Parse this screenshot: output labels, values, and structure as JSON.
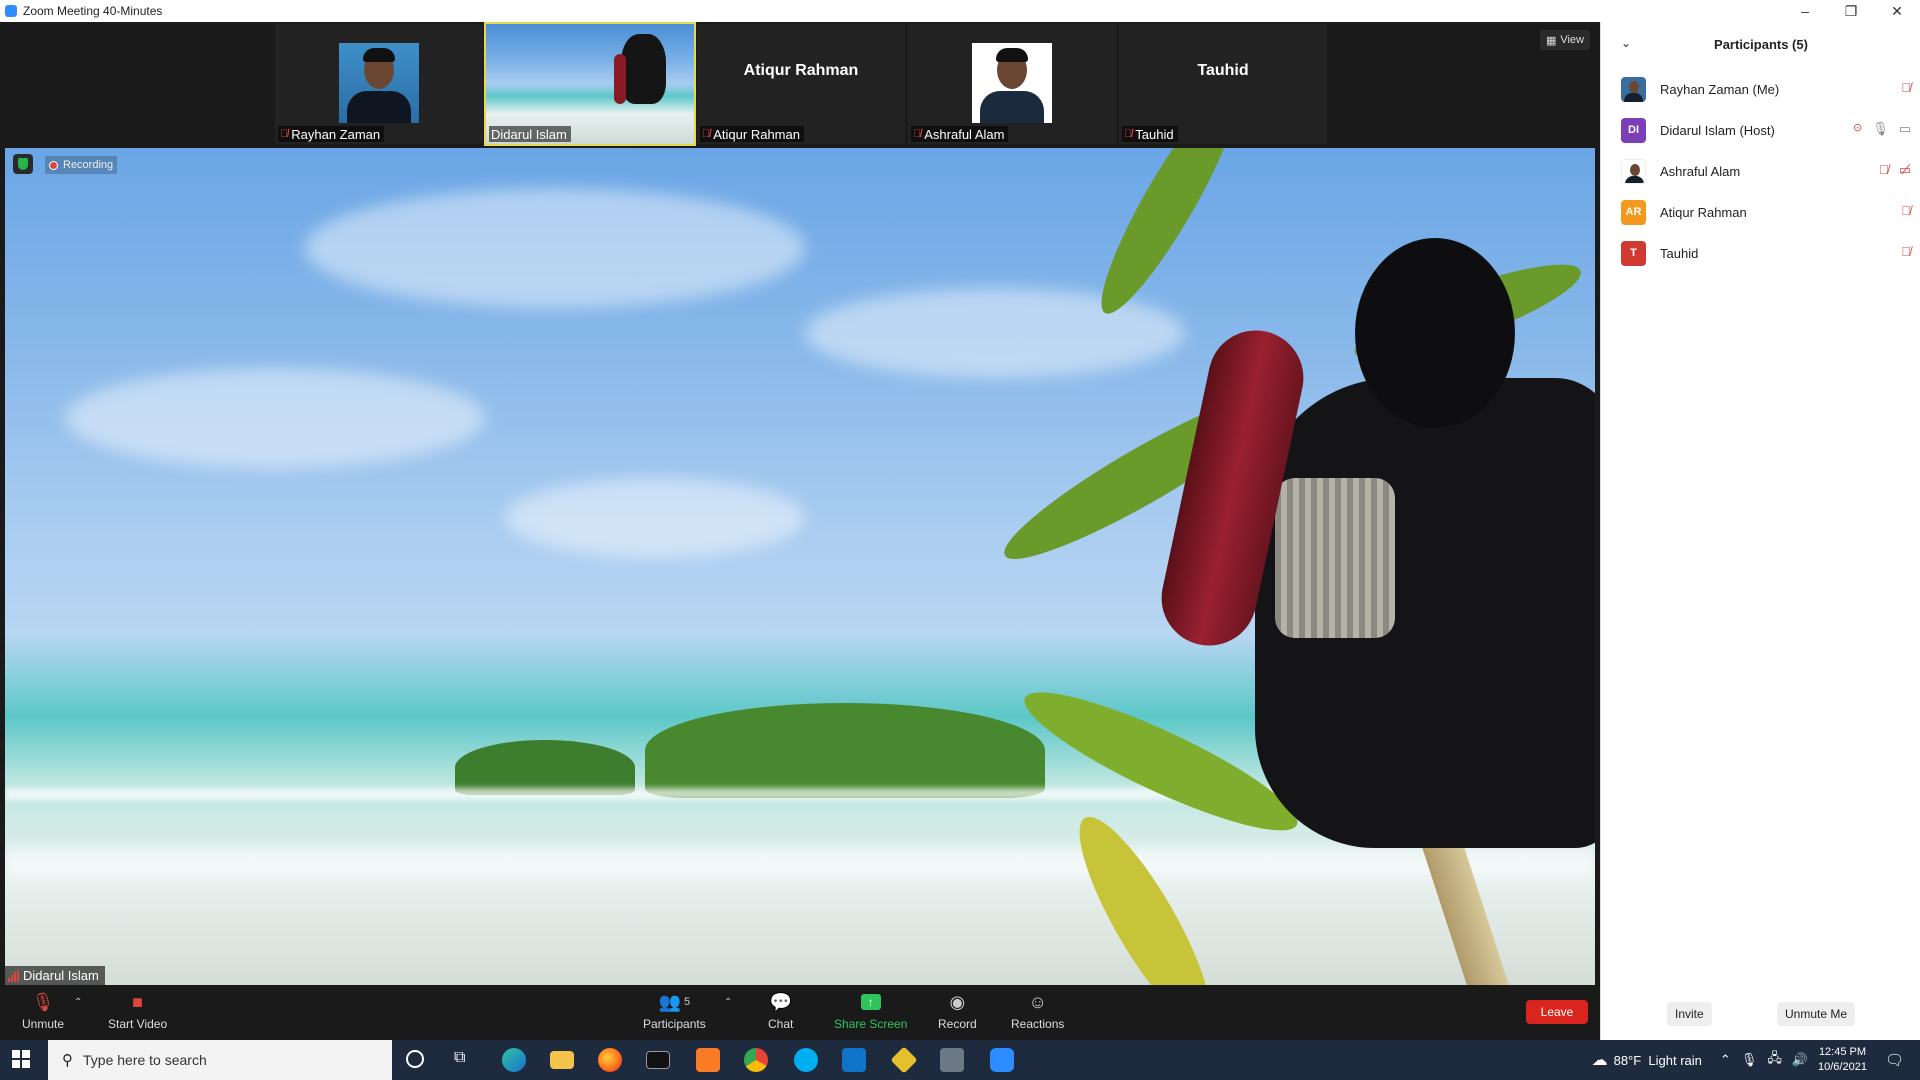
{
  "window": {
    "title": "Zoom Meeting 40-Minutes",
    "minimize": "–",
    "restore": "❐",
    "close": "✕"
  },
  "strip": {
    "view_label": "View",
    "thumbs": [
      {
        "name": "Rayhan Zaman",
        "muted": true,
        "kind": "photo"
      },
      {
        "name": "Didarul Islam",
        "muted": false,
        "kind": "video",
        "active": true
      },
      {
        "name": "Atiqur Rahman",
        "muted": true,
        "kind": "name",
        "big_name": "Atiqur Rahman"
      },
      {
        "name": "Ashraful Alam",
        "muted": true,
        "kind": "photo"
      },
      {
        "name": "Tauhid",
        "muted": true,
        "kind": "name",
        "big_name": "Tauhid"
      }
    ]
  },
  "main_video": {
    "recording_label": "Recording",
    "speaker_name": "Didarul Islam"
  },
  "toolbar": {
    "unmute": "Unmute",
    "start_video": "Start Video",
    "participants": "Participants",
    "participants_count": "5",
    "chat": "Chat",
    "share_screen": "Share Screen",
    "record": "Record",
    "reactions": "Reactions",
    "leave": "Leave"
  },
  "panel": {
    "title": "Participants (5)",
    "participants": [
      {
        "name": "Rayhan Zaman (Me)",
        "avatar": "photo",
        "mic": "muted"
      },
      {
        "name": "Didarul Islam (Host)",
        "avatar": "DI",
        "avatar_color": "#7b3fb8",
        "mic": "on",
        "video": "on",
        "recording": true
      },
      {
        "name": "Ashraful Alam",
        "avatar": "photo",
        "mic": "muted",
        "video": "off"
      },
      {
        "name": "Atiqur Rahman",
        "avatar": "AR",
        "avatar_color": "#f39a1e",
        "mic": "muted"
      },
      {
        "name": "Tauhid",
        "avatar": "T",
        "avatar_color": "#d13a32",
        "mic": "muted"
      }
    ],
    "invite": "Invite",
    "unmute_me": "Unmute Me"
  },
  "taskbar": {
    "search_placeholder": "Type here to search",
    "weather": "88°F  Light rain",
    "time": "12:45 PM",
    "date": "10/6/2021"
  },
  "colors": {
    "accent": "#2d8cff",
    "leave": "#d9251d",
    "share": "#2ec55c",
    "muted": "#e0453b"
  }
}
